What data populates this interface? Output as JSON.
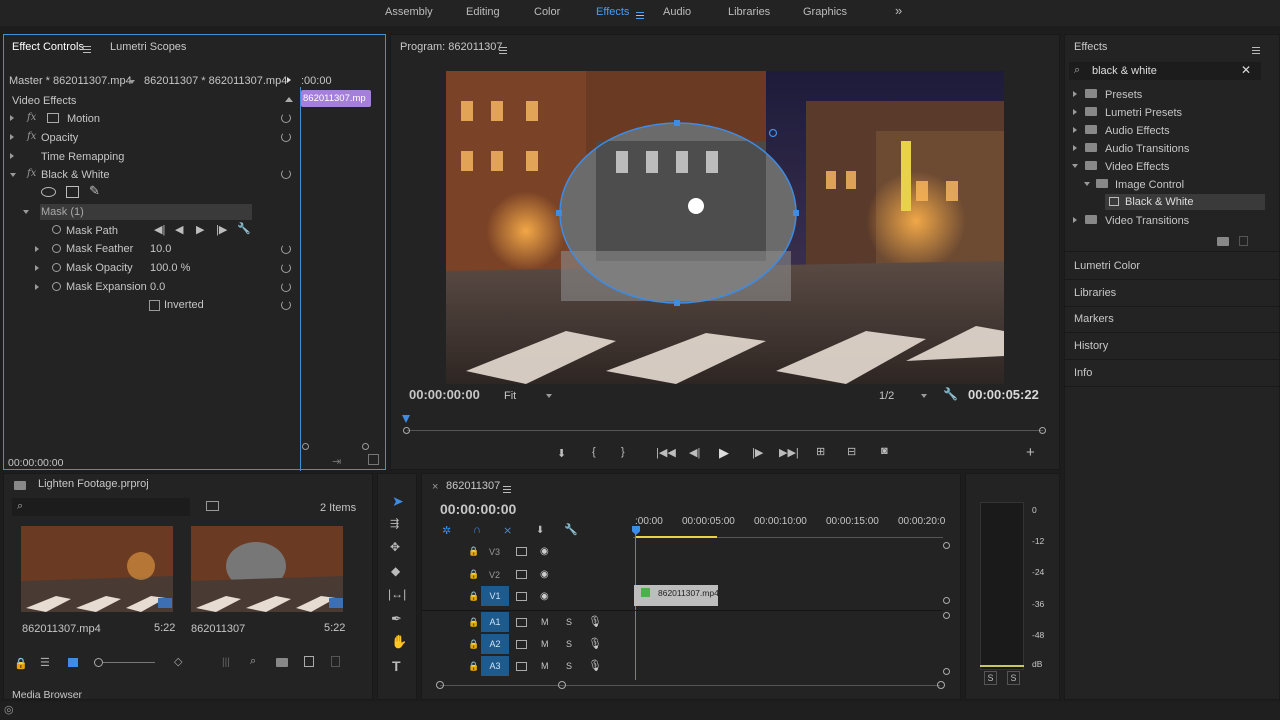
{
  "workspaces": [
    "Assembly",
    "Editing",
    "Color",
    "Effects",
    "Audio",
    "Libraries",
    "Graphics"
  ],
  "active_workspace": "Effects",
  "effect_controls": {
    "tab_active": "Effect Controls",
    "tab_other": "Lumetri Scopes",
    "master_label": "Master * 862011307.mp4",
    "clip_label": "862011307 * 862011307.mp4",
    "timeline_time": ":00:00",
    "clip_bar": "862011307.mp",
    "section": "Video Effects",
    "effects": [
      "Motion",
      "Opacity",
      "Time Remapping",
      "Black & White"
    ],
    "mask": "Mask (1)",
    "props": {
      "mask_path": "Mask Path",
      "mask_feather": "Mask Feather",
      "mask_feather_val": "10.0",
      "mask_opacity": "Mask Opacity",
      "mask_opacity_val": "100.0 %",
      "mask_expansion": "Mask Expansion",
      "mask_expansion_val": "0.0",
      "inverted": "Inverted"
    },
    "timecode": "00:00:00:00"
  },
  "program": {
    "title": "Program: 862011307",
    "timecode_left": "00:00:00:00",
    "fit": "Fit",
    "resolution": "1/2",
    "timecode_right": "00:00:05:22"
  },
  "effects_panel": {
    "title": "Effects",
    "search": "black & white",
    "tree": [
      "Presets",
      "Lumetri Presets",
      "Audio Effects",
      "Audio Transitions",
      "Video Effects",
      "Image Control",
      "Black & White",
      "Video Transitions"
    ],
    "sections": [
      "Lumetri Color",
      "Libraries",
      "Markers",
      "History",
      "Info"
    ]
  },
  "project": {
    "title": "Lighten Footage.prproj",
    "items_count": "2 Items",
    "clips": [
      {
        "name": "862011307.mp4",
        "duration": "5:22"
      },
      {
        "name": "862011307",
        "duration": "5:22"
      }
    ],
    "media_browser": "Media Browser"
  },
  "timeline": {
    "title": "862011307",
    "timecode": "00:00:00:00",
    "ruler": [
      ":00:00",
      "00:00:05:00",
      "00:00:10:00",
      "00:00:15:00",
      "00:00:20:0"
    ],
    "video_tracks": [
      "V3",
      "V2",
      "V1"
    ],
    "audio_tracks": [
      "A1",
      "A2",
      "A3"
    ],
    "clip": "862011307.mp4",
    "m": "M",
    "s": "S"
  },
  "meter": {
    "scale": [
      "0",
      "-12",
      "-24",
      "-36",
      "-48",
      "dB"
    ],
    "solo": [
      "S",
      "S"
    ]
  }
}
